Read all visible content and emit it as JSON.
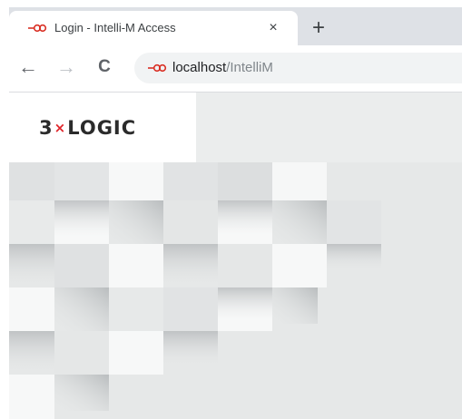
{
  "browser": {
    "tab": {
      "title": "Login - Intelli-M Access",
      "favicon": "insecure-link-icon",
      "close_glyph": "×"
    },
    "new_tab_glyph": "+",
    "nav": {
      "back_glyph": "←",
      "forward_glyph": "→",
      "reload_glyph": "C"
    },
    "address": {
      "host": "localhost",
      "path": "/IntelliM",
      "security_icon": "insecure-link-icon"
    }
  },
  "page": {
    "logo": {
      "prefix": "3",
      "mark": "×",
      "suffix": "LOGIC"
    },
    "colors": {
      "logo_text": "#2b2b2b",
      "logo_accent": "#e0262b",
      "background": "#e6e8e8",
      "tile": "#f7f8f8"
    }
  }
}
